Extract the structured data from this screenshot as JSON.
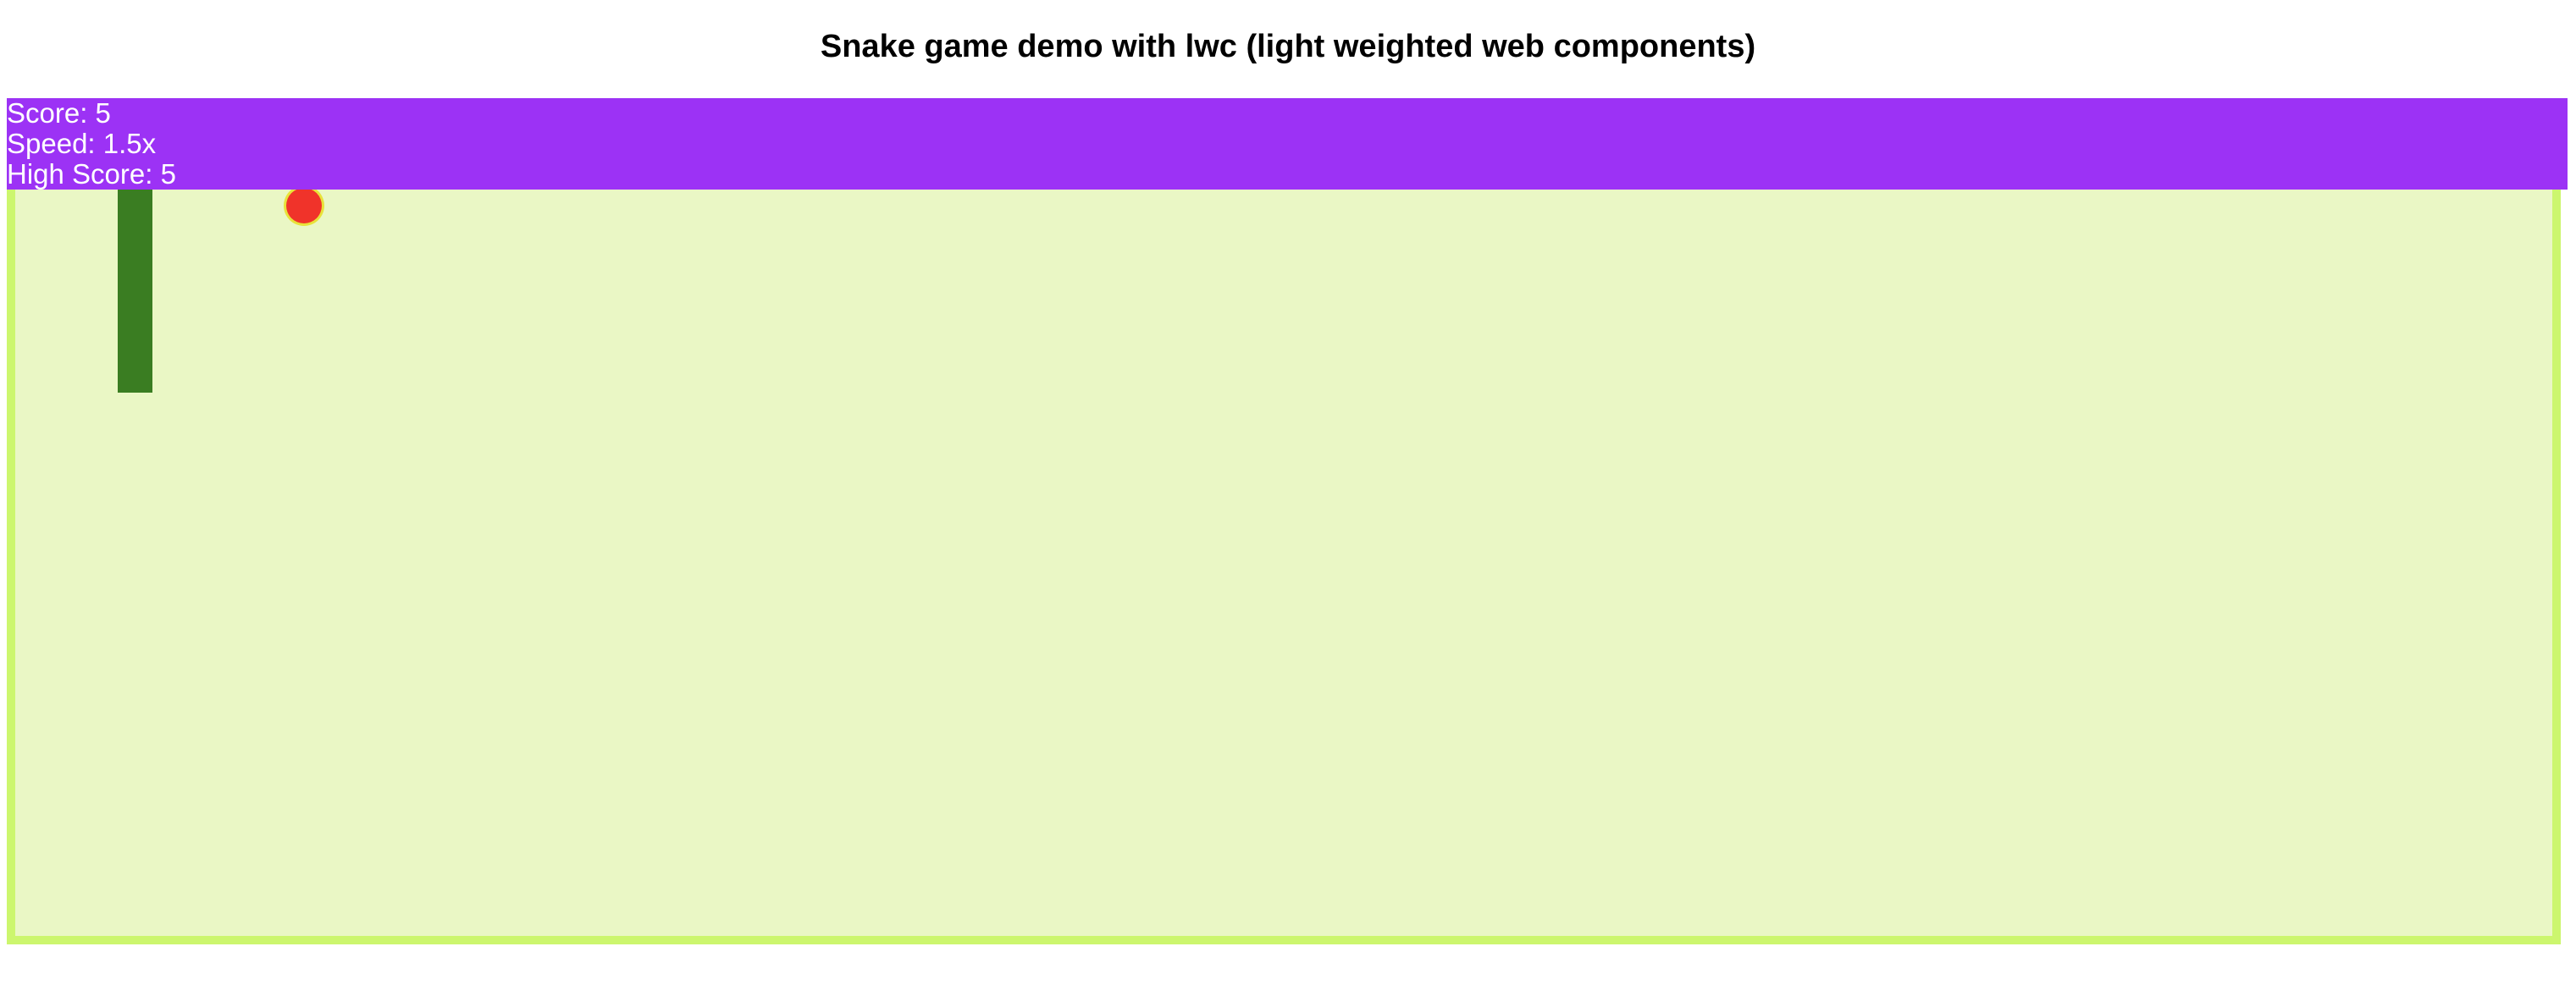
{
  "header": {
    "title": "Snake game demo with lwc (light weighted web components)"
  },
  "scoreboard": {
    "score_text": "Score: 5",
    "speed_text": "Speed: 1.5x",
    "high_score_text": "High Score: 5",
    "background_color": "#9c32f5"
  },
  "game": {
    "board_color": "#eaf7c5",
    "border_color": "#ccf66e",
    "snake_color": "#3a7d22",
    "food_color": "#f0332a"
  }
}
